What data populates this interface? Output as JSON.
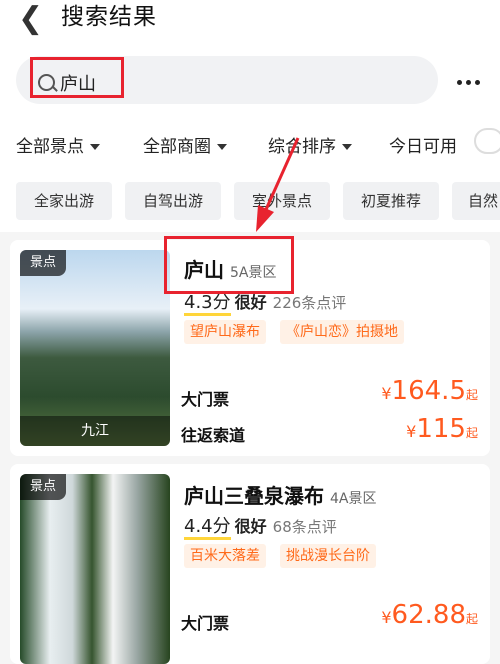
{
  "header": {
    "back_icon": "chevron-left-icon",
    "title": "搜索结果"
  },
  "search": {
    "query": "庐山",
    "icon": "search-icon",
    "more_icon": "more-dots-icon"
  },
  "filters": [
    {
      "label": "全部景点",
      "icon": "caret-down-icon"
    },
    {
      "label": "全部商圈",
      "icon": "caret-down-icon"
    },
    {
      "label": "综合排序",
      "icon": "caret-down-icon"
    },
    {
      "label": "今日可用"
    }
  ],
  "tags": [
    "全家出游",
    "自驾出游",
    "室外景点",
    "初夏推荐",
    "自然"
  ],
  "results": [
    {
      "badge": "景点",
      "city": "九江",
      "name": "庐山",
      "level": "5A景区",
      "score": "4.3分",
      "rating_word": "很好",
      "reviews": "226条点评",
      "chips": [
        "望庐山瀑布",
        "《庐山恋》拍摄地"
      ],
      "tickets": [
        {
          "label": "大门票",
          "symbol": "¥",
          "price": "164.5",
          "suffix": "起"
        },
        {
          "label": "往返索道",
          "symbol": "¥",
          "price": "115",
          "suffix": "起"
        }
      ]
    },
    {
      "badge": "景点",
      "name": "庐山三叠泉瀑布",
      "level": "4A景区",
      "score": "4.4分",
      "rating_word": "很好",
      "reviews": "68条点评",
      "chips": [
        "百米大落差",
        "挑战漫长台阶"
      ],
      "tickets": [
        {
          "label": "大门票",
          "symbol": "¥",
          "price": "62.88",
          "suffix": "起"
        }
      ]
    }
  ],
  "annotation_color": "#e8232f",
  "accent_price_color": "#ff5a1f"
}
